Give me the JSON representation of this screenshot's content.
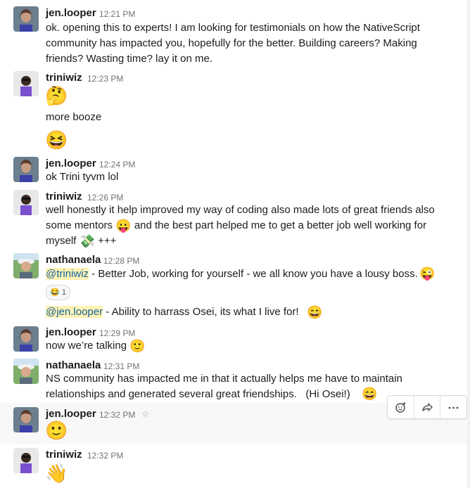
{
  "messages": [
    {
      "user": "jen.looper",
      "time": "12:21 PM",
      "text": "ok. opening this to experts! I am looking for testimonials on how the NativeScript community has impacted you, hopefully for the better. Building careers? Making friends? Wasting time? lay it on me."
    },
    {
      "user": "triniwiz",
      "time": "12:23 PM",
      "emoji1": "🤔",
      "text": "more booze",
      "emoji2": "😆"
    },
    {
      "user": "jen.looper",
      "time": "12:24 PM",
      "text": "ok Trini tyvm lol"
    },
    {
      "user": "triniwiz",
      "time": "12:26 PM",
      "line1": "well honestly it help improved my way of coding also made lots of great friends also",
      "line2a": "some mentors",
      "line2emoji": "😛",
      "line2b": "and the best part helped me to get a better job well working for",
      "line3a": "myself",
      "line3emoji": "💸",
      "line3b": "+++"
    },
    {
      "user": "nathanaela",
      "time": "12:28 PM",
      "mention1": "@triniwiz",
      "text1": " - Better Job, working for yourself - we all know you have a lousy boss.",
      "emoji1": "😜",
      "reaction_emoji": "😂",
      "reaction_count": "1",
      "mention2": "@jen.looper",
      "text2": " - Ability to harrass Osei, its what I live for!",
      "emoji2": "😄"
    },
    {
      "user": "jen.looper",
      "time": "12:29 PM",
      "text": "now we’re talking",
      "emoji": "🙂"
    },
    {
      "user": "nathanaela",
      "time": "12:31 PM",
      "line1": "NS community has impacted me in that it actually helps me have to maintain",
      "line2": "relationships and generated several great friendships.   (Hi Osei!)",
      "emoji": "😄"
    },
    {
      "user": "jen.looper",
      "time": "12:32 PM",
      "emoji": "🙂"
    },
    {
      "user": "triniwiz",
      "time": "12:32 PM",
      "emoji": "👋"
    }
  ],
  "toolbar": {
    "reaction_icon": "add-reaction-icon",
    "share_icon": "share-icon",
    "more_icon": "more-icon"
  },
  "star_icon": "☆",
  "colors": {
    "mention_bg": "#fff2b3",
    "mention_text": "#1264a3",
    "hover_bg": "#f8f8f8"
  }
}
